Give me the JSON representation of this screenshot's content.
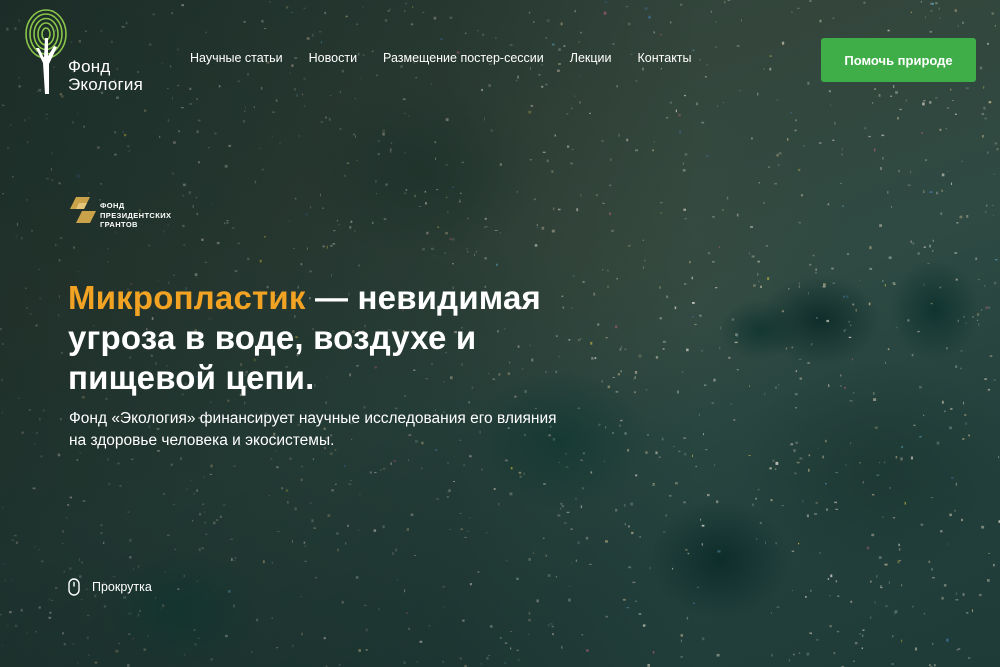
{
  "header": {
    "logo": {
      "line1": "Фонд",
      "line2": "Экология"
    },
    "nav": [
      {
        "label": "Научные статьи"
      },
      {
        "label": "Новости"
      },
      {
        "label": "Размещение постер-сессии"
      },
      {
        "label": "Лекции"
      },
      {
        "label": "Контакты"
      }
    ],
    "cta_label": "Помочь природе"
  },
  "grants_badge": {
    "line1": "ФОНД",
    "line2": "ПРЕЗИДЕНТСКИХ",
    "line3": "ГРАНТОВ"
  },
  "hero": {
    "headline_accent": "Микропластик",
    "headline_rest": " — невидимая угроза в воде, воздухе и пищевой цепи.",
    "subtitle": "Фонд «Экология» финансирует научные исследования его влияния на здоровье человека и экосистемы.",
    "scroll_label": "Прокрутка"
  },
  "colors": {
    "accent_orange": "#f3a323",
    "button_green": "#3fae49",
    "logo_green": "#8ac54b",
    "grants_gold": "#c9a24a"
  },
  "icons": {
    "logo": "tree-fingerprint-icon",
    "grants": "grants-emblem-icon",
    "scroll": "mouse-icon"
  }
}
